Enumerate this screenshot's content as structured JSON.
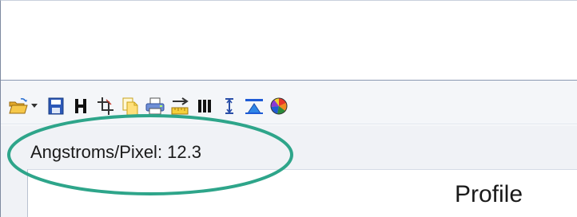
{
  "toolbar": {
    "buttons": [
      {
        "icon": "open-folder-icon"
      },
      {
        "icon": "dropdown-arrow-icon"
      },
      {
        "icon": "save-disk-icon"
      },
      {
        "icon": "h-icon"
      },
      {
        "icon": "crop-tool-icon"
      },
      {
        "icon": "copy-document-icon"
      },
      {
        "icon": "print-icon"
      },
      {
        "icon": "ruler-scale-icon"
      },
      {
        "icon": "bars-icon"
      },
      {
        "icon": "vertical-measure-icon"
      },
      {
        "icon": "triangle-filter-icon"
      },
      {
        "icon": "color-wheel-icon"
      }
    ]
  },
  "status": {
    "label": "Angstroms/Pixel: 12.3"
  },
  "panel": {
    "title": "Profile"
  },
  "colors": {
    "annotation_ellipse": "#2ea58a",
    "toolbar_background": "#f4f6f9",
    "status_background": "#f0f2f6"
  }
}
